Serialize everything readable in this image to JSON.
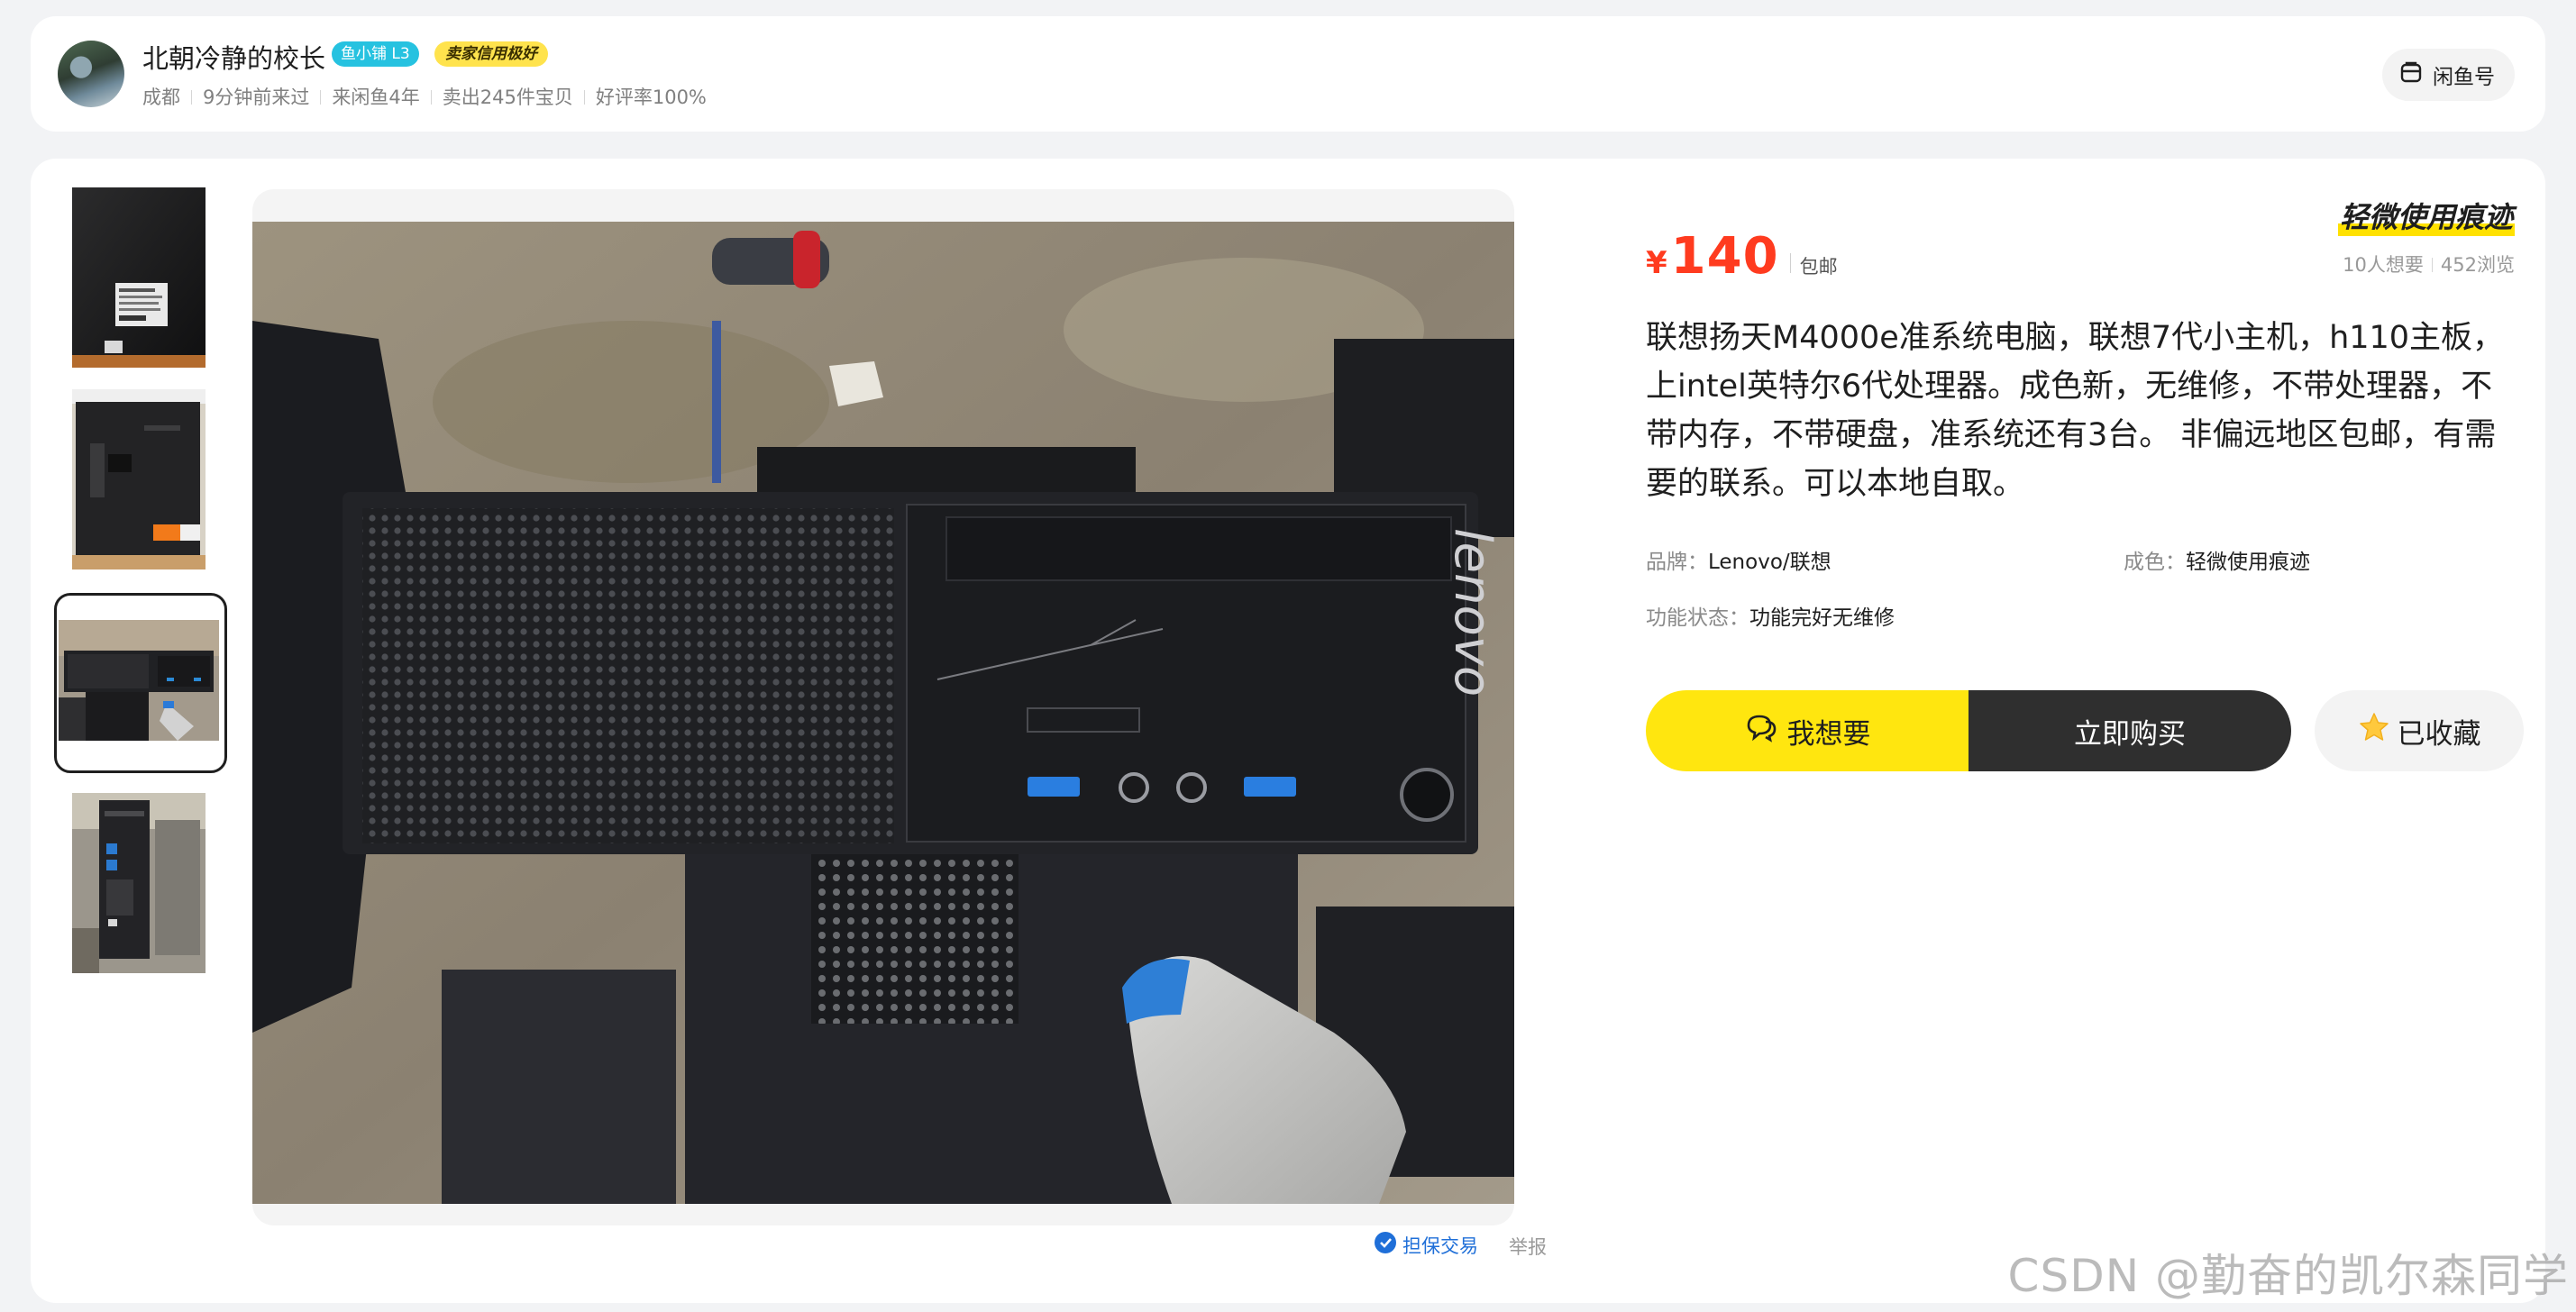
{
  "seller": {
    "name": "北朝冷静的校长",
    "level_badge": "鱼小铺 L3",
    "credit_badge": "卖家信用极好",
    "location": "成都",
    "last_seen": "9分钟前来过",
    "tenure": "来闲鱼4年",
    "sold": "卖出245件宝贝",
    "rating": "好评率100%",
    "xianyu_button": "闲鱼号"
  },
  "product": {
    "price_symbol": "¥",
    "price": "140",
    "shipping": "包邮",
    "condition_tag": "轻微使用痕迹",
    "wants": "10人想要",
    "views": "452浏览",
    "description": "联想扬天M4000e准系统电脑，联想7代小主机，h110主板，上intel英特尔6代处理器。成色新，无维修，不带处理器，不带内存，不带硬盘，准系统还有3台。 非偏远地区包邮，有需要的联系。可以本地自取。",
    "attributes": {
      "brand_label": "品牌：",
      "brand_value": "Lenovo/联想",
      "condition_label": "成色：",
      "condition_value": "轻微使用痕迹",
      "function_label": "功能状态：",
      "function_value": "功能完好无维修"
    }
  },
  "actions": {
    "want": "我想要",
    "buy": "立即购买",
    "favorited": "已收藏",
    "escrow": "担保交易",
    "report": "举报"
  },
  "gallery": {
    "count": 4,
    "selected_index": 2
  },
  "watermark": "CSDN @勤奋的凯尔森同学",
  "colors": {
    "price": "#ff3b1f",
    "want_button": "#ffe60f",
    "buy_button": "#2f2f2f",
    "level_badge": "#26c2e0",
    "credit_badge": "#ffe34d",
    "escrow_link": "#1f6fd8"
  }
}
